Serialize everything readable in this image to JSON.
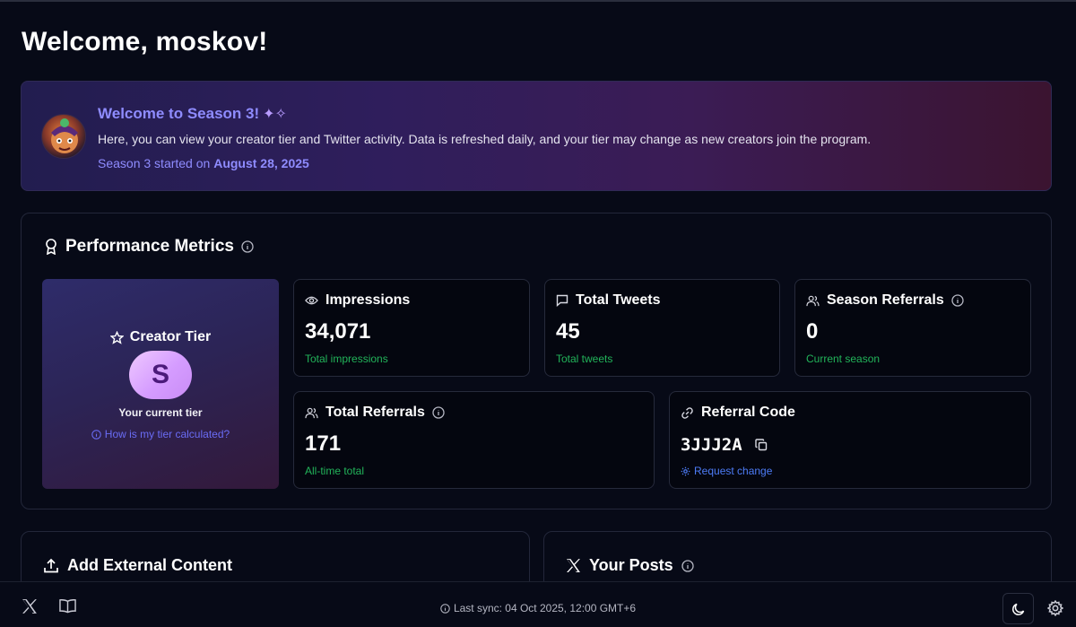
{
  "page": {
    "title": "Welcome, moskov!"
  },
  "banner": {
    "heading": "Welcome to Season 3!",
    "heading_icon": "clapping-hands-icon",
    "description": "Here, you can view your creator tier and Twitter activity. Data is refreshed daily, and your tier may change as new creators join the program.",
    "season_prefix": "Season 3 started on",
    "season_date": "August 28, 2025"
  },
  "performance": {
    "title": "Performance Metrics",
    "tier": {
      "label": "Creator Tier",
      "value": "S",
      "subtitle": "Your current tier",
      "link": "How is my tier calculated?"
    },
    "metrics": {
      "impressions": {
        "label": "Impressions",
        "value": "34,071",
        "sub": "Total impressions"
      },
      "tweets": {
        "label": "Total Tweets",
        "value": "45",
        "sub": "Total tweets"
      },
      "season_referrals": {
        "label": "Season Referrals",
        "value": "0",
        "sub": "Current season"
      },
      "total_referrals": {
        "label": "Total Referrals",
        "value": "171",
        "sub": "All-time total"
      },
      "referral_code": {
        "label": "Referral Code",
        "value": "3JJJ2A",
        "sub": "Request change"
      }
    }
  },
  "sections": {
    "external": {
      "title": "Add External Content"
    },
    "posts": {
      "title": "Your Posts"
    }
  },
  "footer": {
    "sync": "Last sync: 04 Oct 2025, 12:00 GMT+6"
  },
  "colors": {
    "background": "#070a17",
    "accent": "#8f8cff",
    "success": "#22b45a",
    "link": "#4d7cf7"
  }
}
